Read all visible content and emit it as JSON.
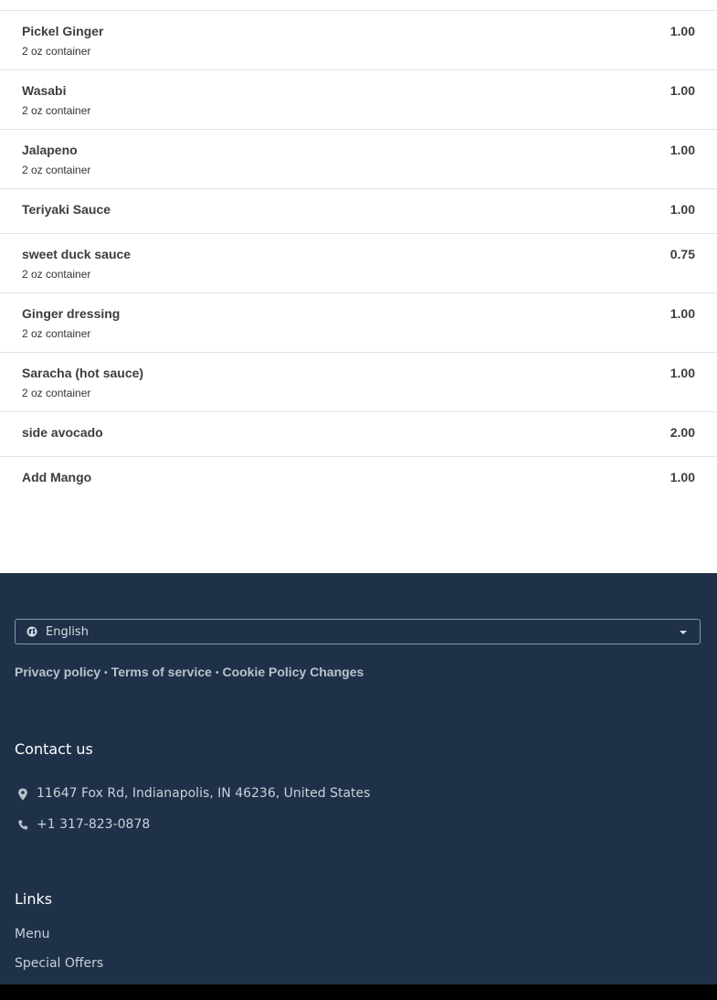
{
  "menu": {
    "items": [
      {
        "name": "Pickel Ginger",
        "desc": "2 oz container",
        "price": "1.00"
      },
      {
        "name": "Wasabi",
        "desc": "2 oz container",
        "price": "1.00"
      },
      {
        "name": "Jalapeno",
        "desc": "2 oz container",
        "price": "1.00"
      },
      {
        "name": "Teriyaki Sauce",
        "desc": "",
        "price": "1.00"
      },
      {
        "name": "sweet duck sauce",
        "desc": "2 oz container",
        "price": "0.75"
      },
      {
        "name": "Ginger dressing",
        "desc": "2 oz container",
        "price": "1.00"
      },
      {
        "name": "Saracha (hot sauce)",
        "desc": "2 oz container",
        "price": "1.00"
      },
      {
        "name": "side avocado",
        "desc": "",
        "price": "2.00"
      },
      {
        "name": "Add Mango",
        "desc": "",
        "price": "1.00"
      }
    ]
  },
  "footer": {
    "language": {
      "selected": "English",
      "icon": "globe-icon"
    },
    "legal": {
      "privacy": "Privacy policy",
      "terms": "Terms of service",
      "cookies": "Cookie Policy Changes",
      "separator": "•"
    },
    "contact": {
      "title": "Contact us",
      "address": "11647 Fox Rd, Indianapolis, IN 46236, United States",
      "phone": "+1 317-823-0878"
    },
    "links": {
      "title": "Links",
      "items": [
        "Menu",
        "Special Offers"
      ]
    }
  },
  "colors": {
    "footer_bg": "#1e3148",
    "bottom_bar": "#000000",
    "item_text": "#3d3d3d"
  }
}
